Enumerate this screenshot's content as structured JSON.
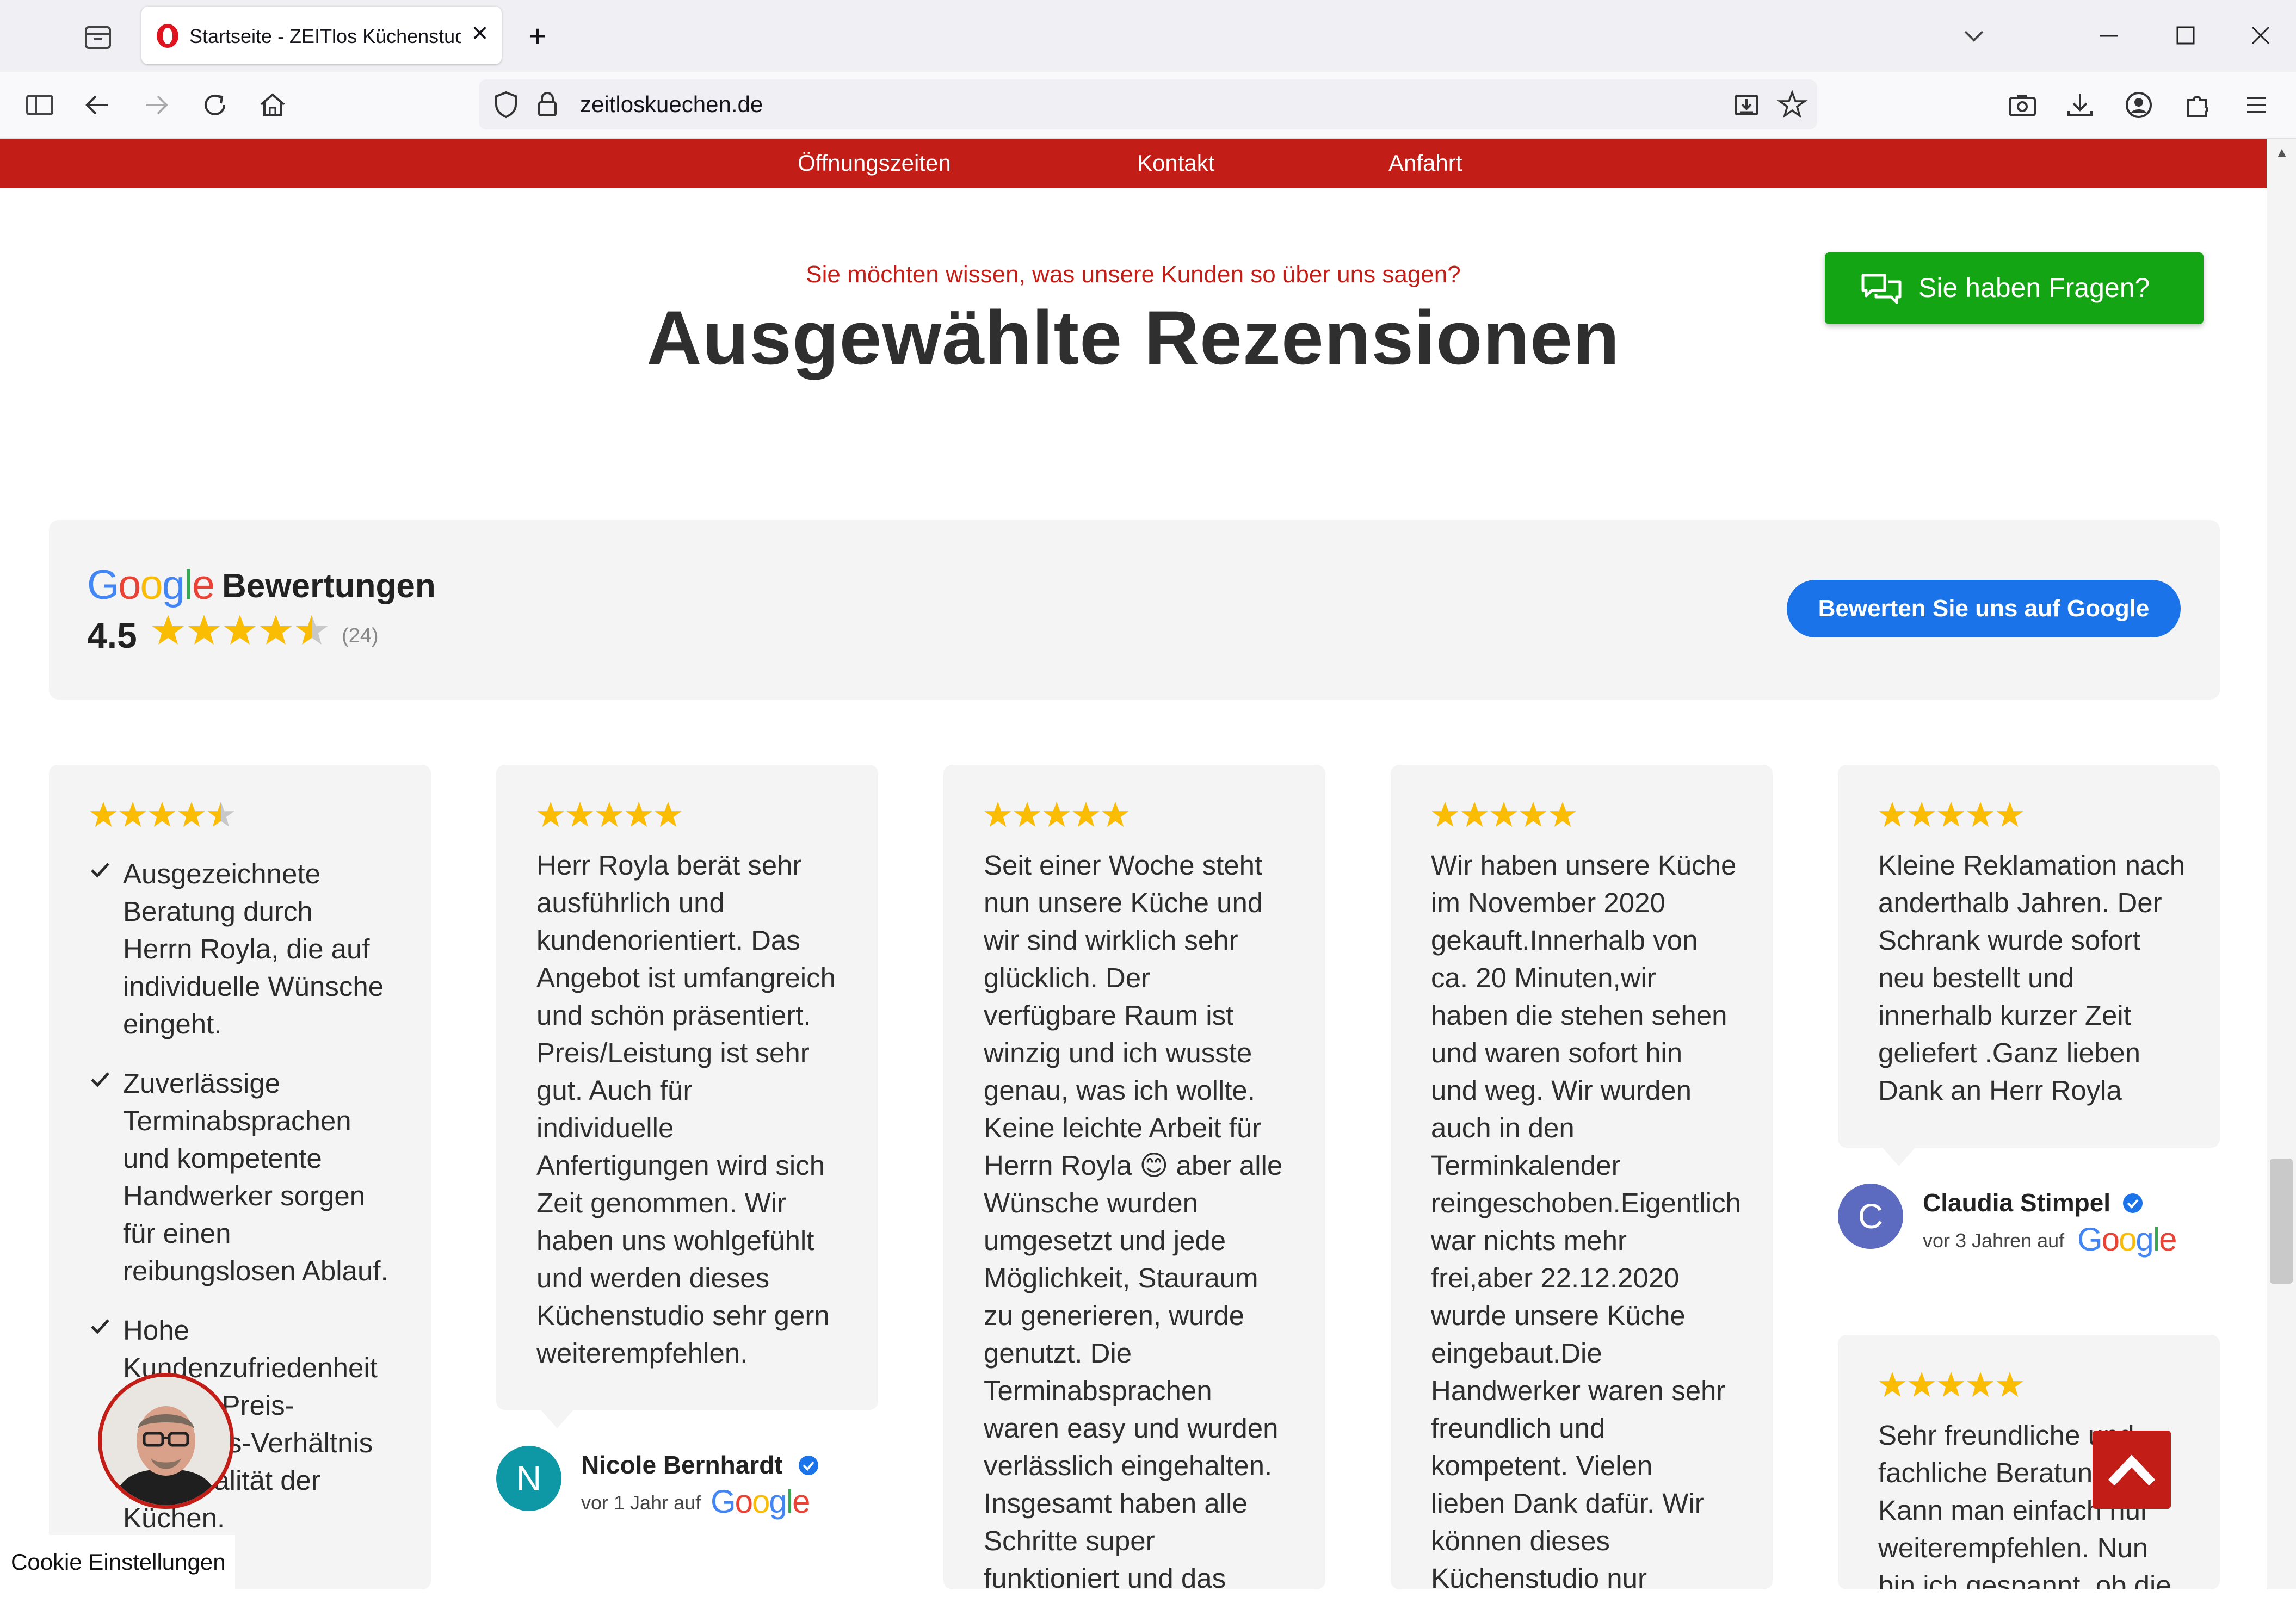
{
  "browser": {
    "tab_title": "Startseite - ZEITlos Küchenstudio",
    "url": "zeitloskuechen.de",
    "close_glyph": "✕",
    "newtab_glyph": "+"
  },
  "nav": {
    "items": [
      "Öffnungszeiten",
      "Kontakt",
      "Anfahrt"
    ]
  },
  "section": {
    "subheading": "Sie möchten wissen, was unsere Kunden so über uns sagen?",
    "heading": "Ausgewählte Rezensionen",
    "faq_button": "Sie haben Fragen?"
  },
  "google_summary": {
    "logo": "Google",
    "label": "Bewertungen",
    "score": "4.5",
    "rating": 4.5,
    "count": "(24)",
    "rate_button": "Bewerten Sie uns auf Google"
  },
  "reviews": [
    {
      "rating": 4.5,
      "checks": [
        [
          "Ausgezeichnete",
          "Beratung durch",
          "Herrn Royla, die auf",
          "individuelle Wünsche",
          "eingeht."
        ],
        [
          "Zuverlässige",
          "Terminabsprachen",
          "und kompetente",
          "Handwerker sorgen",
          "für einen",
          "reibungslosen Ablauf."
        ],
        [
          "Hohe",
          "Kundenzufriedenheit",
          "und ein Preis-",
          "Leistungs-Verhältnis",
          "und Qualität der",
          "Küchen."
        ]
      ]
    },
    {
      "rating": 5,
      "lines": [
        "Herr Royla berät sehr",
        "ausführlich und",
        "kundenorientiert. Das",
        "Angebot ist umfangreich",
        "und schön präsentiert.",
        "Preis/Leistung ist sehr",
        "gut. Auch für",
        "individuelle",
        "Anfertigungen wird sich",
        "Zeit genommen. Wir",
        "haben uns wohlgefühlt",
        "und werden dieses",
        "Küchenstudio sehr gern",
        "weiterempfehlen."
      ],
      "author": "Nicole Bernhardt",
      "initial": "N",
      "avatar_color": "#0e97a4",
      "meta": "vor 1 Jahr auf",
      "source": "Google"
    },
    {
      "rating": 5,
      "lines": [
        "Seit einer Woche steht",
        "nun unsere Küche und",
        "wir sind wirklich sehr",
        "glücklich. Der",
        "verfügbare Raum ist",
        "winzig und ich wusste",
        "genau, was ich wollte.",
        "Keine leichte Arbeit für",
        "Herrn Royla 😊 aber alle",
        "Wünsche wurden",
        "umgesetzt und jede",
        "Möglichkeit, Stauraum",
        "zu generieren, wurde",
        "genutzt. Die",
        "Terminabsprachen",
        "waren easy und wurden",
        "verlässlich eingehalten.",
        "Insgesamt haben alle",
        "Schritte super",
        "funktioniert und das"
      ]
    },
    {
      "rating": 5,
      "lines": [
        "Wir haben unsere Küche",
        "im November 2020",
        "gekauft.Innerhalb von",
        "ca. 20 Minuten,wir",
        "haben die stehen sehen",
        "und waren sofort hin",
        "und weg. Wir wurden",
        "auch in den",
        "Terminkalender",
        "reingeschoben.Eigentlich",
        "war nichts mehr",
        "frei,aber 22.12.2020",
        "wurde unsere Küche",
        "eingebaut.Die",
        "Handwerker waren sehr",
        "freundlich und",
        "kompetent. Vielen",
        "lieben Dank dafür. Wir",
        "können dieses",
        "Küchenstudio nur"
      ]
    },
    {
      "rating": 5,
      "lines": [
        "Kleine Reklamation nach",
        "anderthalb Jahren. Der",
        "Schrank wurde sofort",
        "neu bestellt und",
        "innerhalb kurzer Zeit",
        "geliefert .Ganz lieben",
        "Dank an Herr Royla"
      ],
      "author": "Claudia Stimpel",
      "initial": "C",
      "avatar_color": "#5c6bc0",
      "meta": "vor 3 Jahren auf",
      "source": "Google"
    },
    {
      "rating": 5,
      "lines": [
        "Sehr freundliche und",
        "fachliche Beratung.",
        "Kann man einfach nur",
        "weiterempfehlen. Nun",
        "bin ich gespannt, ob die"
      ]
    }
  ],
  "footer": {
    "cookie_label": "Cookie Einstellungen"
  },
  "colors": {
    "brand_red": "#c31d17",
    "faq_green": "#14a514",
    "google_blue": "#1a73e8",
    "star": "#fbbc04"
  },
  "icons": [
    "tab-overview-icon",
    "opera-favicon-icon",
    "sidebar-icon",
    "back-icon",
    "forward-icon",
    "reload-icon",
    "home-icon",
    "shield-icon",
    "lock-icon",
    "install-icon",
    "bookmark-star-icon",
    "screenshot-icon",
    "download-icon",
    "account-icon",
    "extensions-icon",
    "menu-icon",
    "chat-bubbles-icon",
    "check-icon",
    "verified-badge-icon",
    "chevron-up-icon"
  ]
}
